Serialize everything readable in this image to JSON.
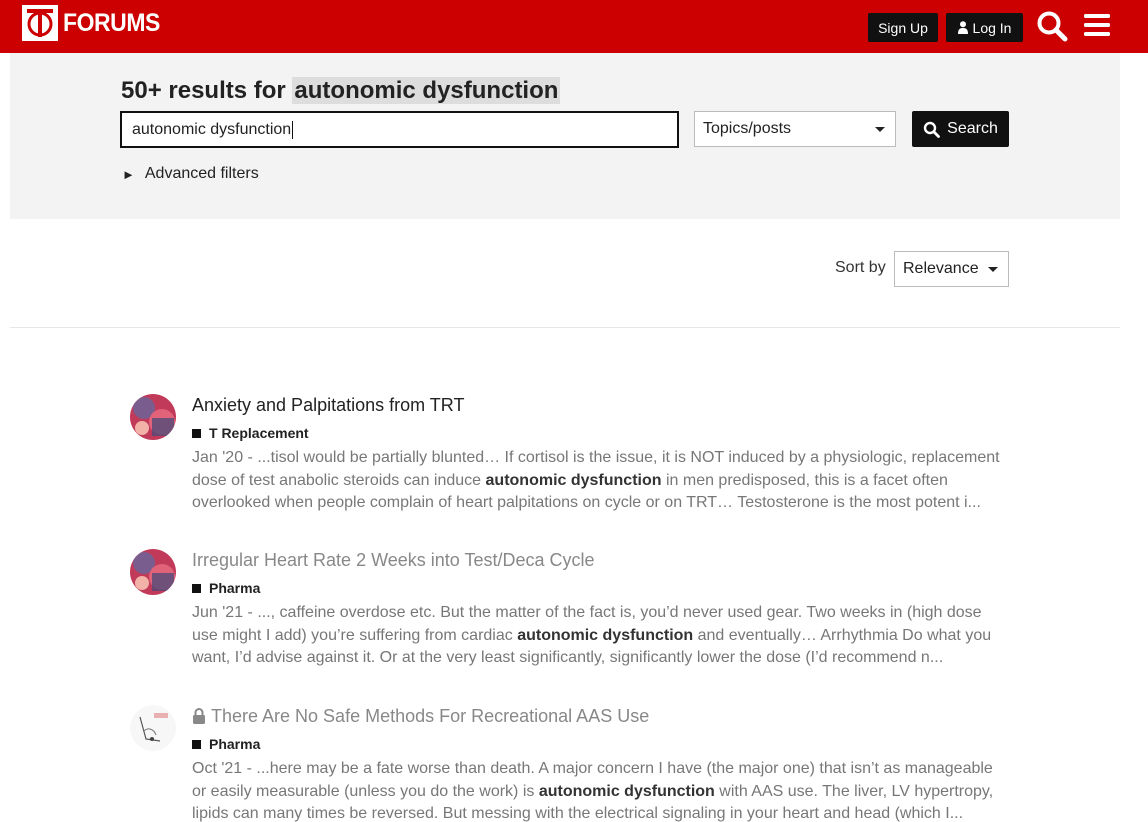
{
  "header": {
    "logo_text": "FORUMS",
    "signup_label": "Sign Up",
    "login_label": "Log In",
    "brand_color": "#cc0000"
  },
  "search": {
    "title_prefix": "50+ results for",
    "title_term": "autonomic dysfunction",
    "query": "autonomic dysfunction",
    "type_selected": "Topics/posts",
    "button_label": "Search",
    "advanced_label": "Advanced filters"
  },
  "sort": {
    "label": "Sort by",
    "selected": "Relevance"
  },
  "results": [
    {
      "title": "Anxiety and Palpitations from TRT",
      "category": "T Replacement",
      "date": "Jan '20",
      "pre": " - ...tisol would be partially blunted… If cortisol is the issue, it is NOT induced by a physiologic, replacement dose of test anabolic steroids can induce ",
      "term": "autonomic dysfunction",
      "post": " in men predisposed, this is a facet often overlooked when people complain of heart palpitations on cycle or on TRT… Testosterone is the most potent i..."
    },
    {
      "title": "Irregular Heart Rate 2 Weeks into Test/Deca Cycle",
      "category": "Pharma",
      "date": "Jun '21",
      "pre": " - ..., caffeine overdose etc. But the matter of the fact is, you’d never used gear. Two weeks in (high dose use might I add) you’re suffering from cardiac ",
      "term": "autonomic dysfunction",
      "post": " and eventually… Arrhythmia Do what you want, I’d advise against it. Or at the very least significantly, significantly lower the dose (I’d recommend n..."
    },
    {
      "title": "There Are No Safe Methods For Recreational AAS Use",
      "category": "Pharma",
      "date": "Oct '21",
      "pre": " - ...here may be a fate worse than death. A major concern I have (the major one) that isn’t as manageable or easily measurable (unless you do the work) is ",
      "term": "autonomic dysfunction",
      "post": " with AAS use. The liver, LV hypertropy, lipids can many times be reversed. But messing with the electrical signaling in your heart and head (which I..."
    }
  ]
}
